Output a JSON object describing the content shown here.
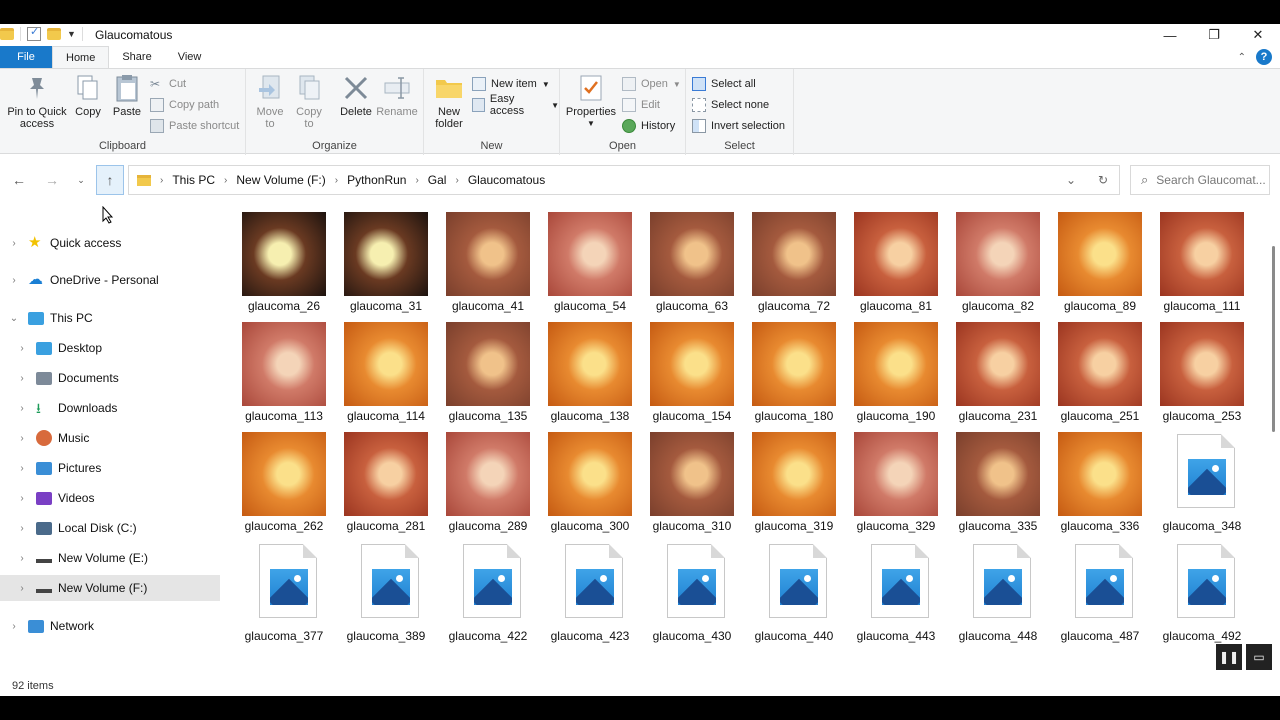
{
  "window": {
    "title": "Glaucomatous"
  },
  "ribbon_tabs": [
    "File",
    "Home",
    "Share",
    "View"
  ],
  "ribbon": {
    "clipboard": {
      "label": "Clipboard",
      "pin": "Pin to Quick access",
      "copy": "Copy",
      "paste": "Paste",
      "cut": "Cut",
      "copy_path": "Copy path",
      "paste_shortcut": "Paste shortcut"
    },
    "organize": {
      "label": "Organize",
      "move_to": "Move to",
      "copy_to": "Copy to",
      "delete": "Delete",
      "rename": "Rename"
    },
    "new": {
      "label": "New",
      "new_folder": "New folder",
      "new_item": "New item",
      "easy_access": "Easy access"
    },
    "open": {
      "label": "Open",
      "properties": "Properties",
      "open": "Open",
      "edit": "Edit",
      "history": "History"
    },
    "select": {
      "label": "Select",
      "select_all": "Select all",
      "select_none": "Select none",
      "invert": "Invert selection"
    }
  },
  "address": {
    "breadcrumb": [
      "This PC",
      "New Volume (F:)",
      "PythonRun",
      "Gal",
      "Glaucomatous"
    ],
    "search_placeholder": "Search Glaucomat..."
  },
  "sidebar": [
    {
      "label": "Quick access",
      "icon": "star-icon",
      "color": "#f2c200"
    },
    {
      "label": "OneDrive - Personal",
      "icon": "cloud-icon",
      "color": "#1a7fd4"
    },
    {
      "label": "This PC",
      "icon": "computer-icon",
      "color": "#3aa0e0"
    },
    {
      "label": "Desktop",
      "icon": "desktop-icon",
      "color": "#3aa0e0"
    },
    {
      "label": "Documents",
      "icon": "documents-icon",
      "color": "#7d8a99"
    },
    {
      "label": "Downloads",
      "icon": "download-icon",
      "color": "#1e9c5a"
    },
    {
      "label": "Music",
      "icon": "music-icon",
      "color": "#d86a3c"
    },
    {
      "label": "Pictures",
      "icon": "pictures-icon",
      "color": "#3a8ed6"
    },
    {
      "label": "Videos",
      "icon": "videos-icon",
      "color": "#7a3fc4"
    },
    {
      "label": "Local Disk (C:)",
      "icon": "drive-c-icon",
      "color": "#4a6a8a"
    },
    {
      "label": "New Volume (E:)",
      "icon": "drive-icon",
      "color": "#444444"
    },
    {
      "label": "New Volume (F:)",
      "icon": "drive-icon",
      "color": "#444444"
    },
    {
      "label": "Network",
      "icon": "network-icon",
      "color": "#3a8ed6"
    }
  ],
  "files": [
    {
      "name": "glaucoma_26",
      "thumb": "dark"
    },
    {
      "name": "glaucoma_31",
      "thumb": "dark"
    },
    {
      "name": "glaucoma_41",
      "thumb": "brown"
    },
    {
      "name": "glaucoma_54",
      "thumb": "pink"
    },
    {
      "name": "glaucoma_63",
      "thumb": "brown"
    },
    {
      "name": "glaucoma_72",
      "thumb": "brown"
    },
    {
      "name": "glaucoma_81",
      "thumb": "red"
    },
    {
      "name": "glaucoma_82",
      "thumb": "pink"
    },
    {
      "name": "glaucoma_89",
      "thumb": "orange"
    },
    {
      "name": "glaucoma_111",
      "thumb": "red"
    },
    {
      "name": "glaucoma_113",
      "thumb": "pink"
    },
    {
      "name": "glaucoma_114",
      "thumb": "orange"
    },
    {
      "name": "glaucoma_135",
      "thumb": "brown"
    },
    {
      "name": "glaucoma_138",
      "thumb": "orange"
    },
    {
      "name": "glaucoma_154",
      "thumb": "orange"
    },
    {
      "name": "glaucoma_180",
      "thumb": "orange"
    },
    {
      "name": "glaucoma_190",
      "thumb": "orange"
    },
    {
      "name": "glaucoma_231",
      "thumb": "red"
    },
    {
      "name": "glaucoma_251",
      "thumb": "red"
    },
    {
      "name": "glaucoma_253",
      "thumb": "red"
    },
    {
      "name": "glaucoma_262",
      "thumb": "orange"
    },
    {
      "name": "glaucoma_281",
      "thumb": "red"
    },
    {
      "name": "glaucoma_289",
      "thumb": "pink"
    },
    {
      "name": "glaucoma_300",
      "thumb": "orange"
    },
    {
      "name": "glaucoma_310",
      "thumb": "brown"
    },
    {
      "name": "glaucoma_319",
      "thumb": "orange"
    },
    {
      "name": "glaucoma_329",
      "thumb": "pink"
    },
    {
      "name": "glaucoma_335",
      "thumb": "brown"
    },
    {
      "name": "glaucoma_336",
      "thumb": "orange"
    },
    {
      "name": "glaucoma_348",
      "thumb": "icon"
    },
    {
      "name": "glaucoma_377",
      "thumb": "icon"
    },
    {
      "name": "glaucoma_389",
      "thumb": "icon"
    },
    {
      "name": "glaucoma_422",
      "thumb": "icon"
    },
    {
      "name": "glaucoma_423",
      "thumb": "icon"
    },
    {
      "name": "glaucoma_430",
      "thumb": "icon"
    },
    {
      "name": "glaucoma_440",
      "thumb": "icon"
    },
    {
      "name": "glaucoma_443",
      "thumb": "icon"
    },
    {
      "name": "glaucoma_448",
      "thumb": "icon"
    },
    {
      "name": "glaucoma_487",
      "thumb": "icon"
    },
    {
      "name": "glaucoma_492",
      "thumb": "icon"
    }
  ],
  "status": {
    "item_count": "92 items"
  },
  "colors": {
    "accent": "#1979ca",
    "selected": "#e5e5e5"
  }
}
